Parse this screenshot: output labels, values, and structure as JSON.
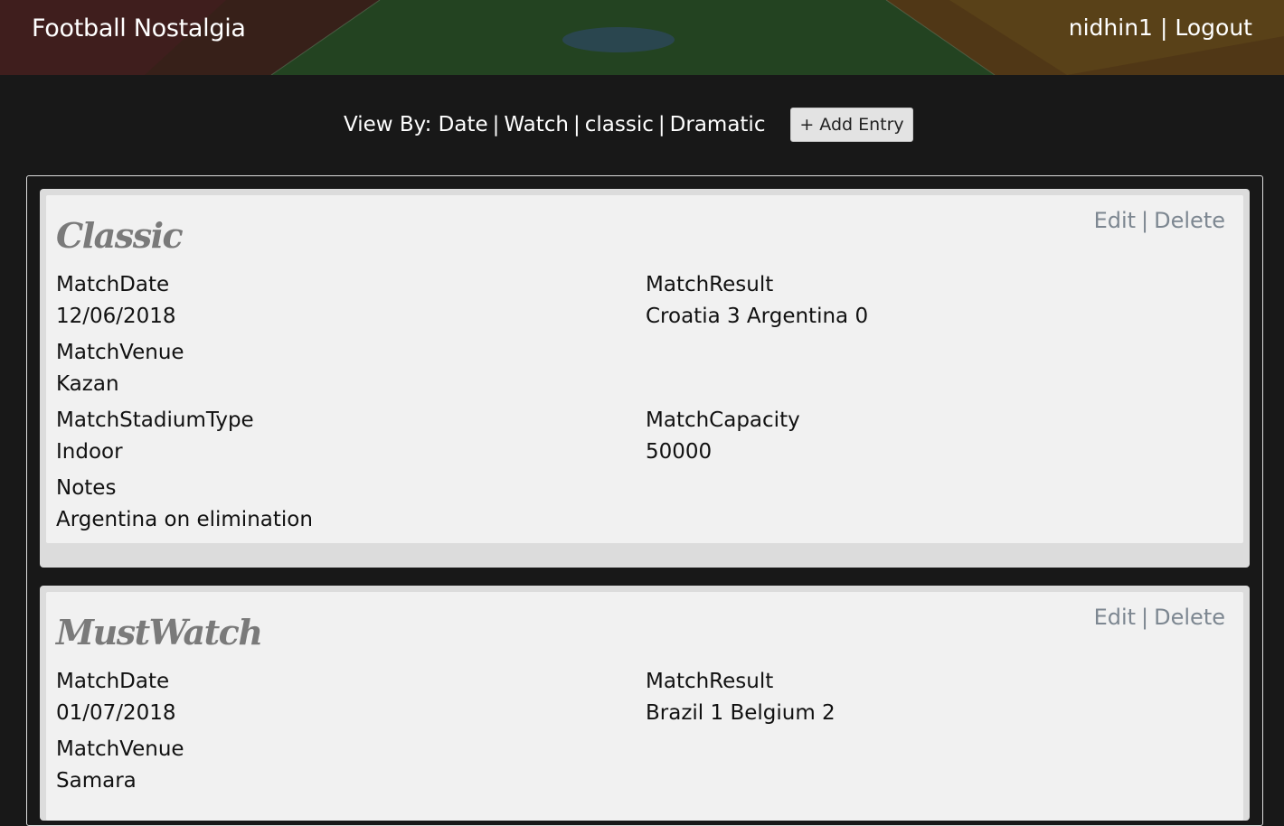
{
  "header": {
    "brand": "Football Nostalgia",
    "username": "nidhin1",
    "separator": "|",
    "logout": "Logout"
  },
  "viewbar": {
    "prefix": "View By:",
    "options": [
      "Date",
      "Watch",
      "classic",
      "Dramatic"
    ],
    "separator": "|",
    "add_button": "+ Add Entry"
  },
  "entries": [
    {
      "title": "Classic",
      "edit": "Edit",
      "delete": "Delete",
      "separator": "|",
      "date_label": "MatchDate",
      "date": "12/06/2018",
      "result_label": "MatchResult",
      "result": "Croatia 3 Argentina 0",
      "venue_label": "MatchVenue",
      "venue": "Kazan",
      "stadium_type_label": "MatchStadiumType",
      "stadium_type": "Indoor",
      "capacity_label": "MatchCapacity",
      "capacity": "50000",
      "notes_label": "Notes",
      "notes": "Argentina on elimination"
    },
    {
      "title": "MustWatch",
      "edit": "Edit",
      "delete": "Delete",
      "separator": "|",
      "date_label": "MatchDate",
      "date": "01/07/2018",
      "result_label": "MatchResult",
      "result": "Brazil 1 Belgium 2",
      "venue_label": "MatchVenue",
      "venue": "Samara"
    }
  ]
}
